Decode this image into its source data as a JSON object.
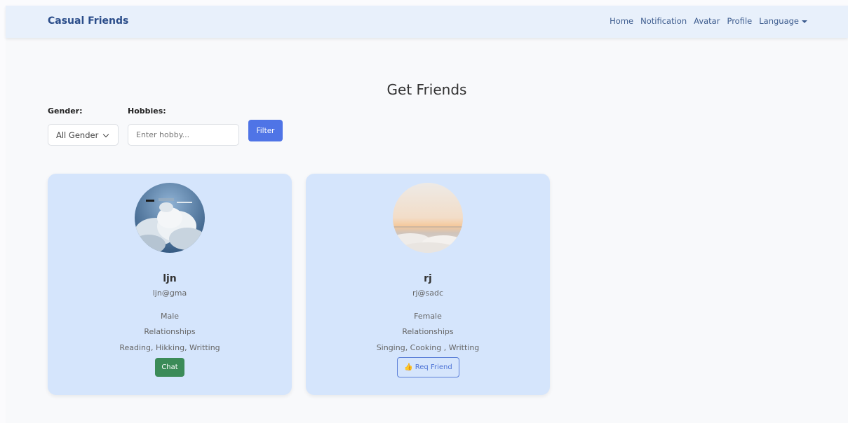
{
  "navbar": {
    "brand": "Casual Friends",
    "links": [
      "Home",
      "Notification",
      "Avatar",
      "Profile"
    ],
    "language_label": "Language"
  },
  "page_title": "Get Friends",
  "filters": {
    "gender_label": "Gender:",
    "gender_selected": "All Gender",
    "hobbies_label": "Hobbies:",
    "hobby_placeholder": "Enter hobby...",
    "filter_label": "Filter"
  },
  "cards": [
    {
      "name": "ljn",
      "email": "ljn@gma",
      "gender": "Male",
      "looking_for": "Relationships",
      "hobbies": "Reading, Hikking, Writting",
      "action_label": "Chat"
    },
    {
      "name": "rj",
      "email": "rj@sadc",
      "gender": "Female",
      "looking_for": "Relationships",
      "hobbies": "Singing, Cooking , Writting",
      "action_icon": "👍",
      "action_label": "Req Friend"
    }
  ],
  "colors": {
    "navbar_bg": "#e8f0fb",
    "card_bg": "#d5e5fc",
    "filter_button": "#4f74e6",
    "chat_button": "#3b8b58"
  }
}
